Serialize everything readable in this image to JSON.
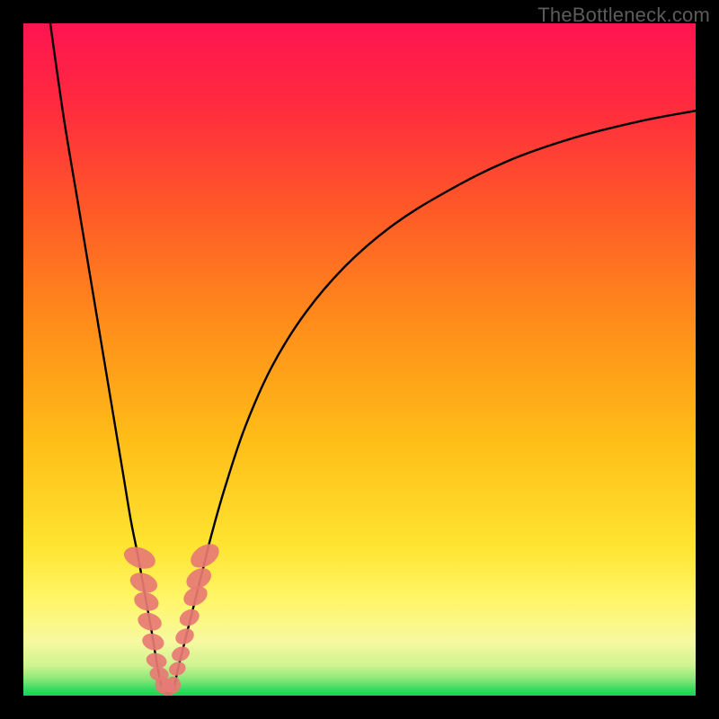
{
  "watermark": "TheBottleneck.com",
  "chart_data": {
    "type": "line",
    "title": "",
    "xlabel": "",
    "ylabel": "",
    "xlim": [
      0,
      100
    ],
    "ylim": [
      0,
      100
    ],
    "series": [
      {
        "name": "left-branch",
        "x": [
          4,
          6,
          8,
          10,
          12,
          14,
          15,
          16,
          17,
          18,
          19,
          19.5,
          20,
          20.6
        ],
        "y": [
          100,
          86,
          74,
          62,
          50,
          38,
          32,
          26,
          21,
          15.5,
          10,
          7,
          4,
          1
        ]
      },
      {
        "name": "right-branch",
        "x": [
          22.4,
          23,
          24,
          25,
          26,
          27,
          28,
          30,
          33,
          37,
          42,
          48,
          55,
          63,
          72,
          82,
          92,
          100
        ],
        "y": [
          1,
          4,
          8,
          12,
          16,
          20,
          24,
          31,
          40,
          49,
          57,
          64,
          70,
          75,
          79.5,
          83,
          85.5,
          87
        ]
      },
      {
        "name": "valley-floor",
        "x": [
          20.6,
          21,
          21.5,
          22,
          22.4
        ],
        "y": [
          1,
          0.4,
          0.3,
          0.4,
          1
        ]
      }
    ],
    "gradient_stops": [
      {
        "offset": 0,
        "color": "#ff1450"
      },
      {
        "offset": 0.12,
        "color": "#ff2a3f"
      },
      {
        "offset": 0.28,
        "color": "#ff5a27"
      },
      {
        "offset": 0.45,
        "color": "#ff8e1a"
      },
      {
        "offset": 0.62,
        "color": "#ffbd18"
      },
      {
        "offset": 0.78,
        "color": "#ffe532"
      },
      {
        "offset": 0.86,
        "color": "#fff66a"
      },
      {
        "offset": 0.92,
        "color": "#f6f9a0"
      },
      {
        "offset": 0.955,
        "color": "#cff390"
      },
      {
        "offset": 0.975,
        "color": "#8be878"
      },
      {
        "offset": 0.99,
        "color": "#3adb63"
      },
      {
        "offset": 1.0,
        "color": "#17d455"
      }
    ],
    "markers": {
      "color": "#e77a74",
      "left_cluster": [
        {
          "x": 17.3,
          "y": 20.5,
          "rx": 2.7,
          "ry": 4.4,
          "rot": -70
        },
        {
          "x": 17.9,
          "y": 16.8,
          "rx": 2.5,
          "ry": 3.8,
          "rot": -70
        },
        {
          "x": 18.3,
          "y": 14.0,
          "rx": 2.4,
          "ry": 3.4,
          "rot": -72
        },
        {
          "x": 18.8,
          "y": 11.0,
          "rx": 2.3,
          "ry": 3.3,
          "rot": -72
        },
        {
          "x": 19.3,
          "y": 8.0,
          "rx": 2.2,
          "ry": 3.0,
          "rot": -74
        },
        {
          "x": 19.8,
          "y": 5.2,
          "rx": 2.0,
          "ry": 2.8,
          "rot": -76
        },
        {
          "x": 20.2,
          "y": 3.2,
          "rx": 1.9,
          "ry": 2.6,
          "rot": -80
        }
      ],
      "right_cluster": [
        {
          "x": 25.6,
          "y": 14.8,
          "rx": 2.4,
          "ry": 3.4,
          "rot": 62
        },
        {
          "x": 26.1,
          "y": 17.4,
          "rx": 2.5,
          "ry": 3.6,
          "rot": 60
        },
        {
          "x": 27.0,
          "y": 20.8,
          "rx": 2.7,
          "ry": 4.2,
          "rot": 58
        },
        {
          "x": 24.7,
          "y": 11.6,
          "rx": 2.1,
          "ry": 2.8,
          "rot": 62
        },
        {
          "x": 24.0,
          "y": 8.8,
          "rx": 2.0,
          "ry": 2.6,
          "rot": 64
        },
        {
          "x": 23.4,
          "y": 6.2,
          "rx": 1.9,
          "ry": 2.5,
          "rot": 68
        },
        {
          "x": 22.9,
          "y": 4.0,
          "rx": 1.8,
          "ry": 2.3,
          "rot": 72
        }
      ],
      "bottom_cluster": [
        {
          "x": 20.7,
          "y": 1.6,
          "rx": 2.0,
          "ry": 2.3,
          "rot": 0
        },
        {
          "x": 21.5,
          "y": 1.1,
          "rx": 2.0,
          "ry": 2.1,
          "rot": 0
        },
        {
          "x": 22.3,
          "y": 1.6,
          "rx": 2.0,
          "ry": 2.3,
          "rot": 0
        }
      ]
    }
  }
}
